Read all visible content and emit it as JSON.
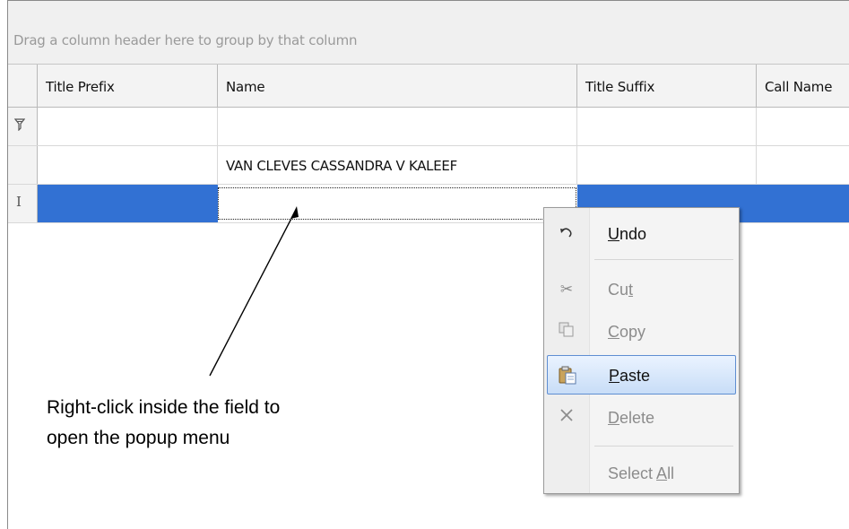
{
  "grid": {
    "group_panel_text": "Drag a column header here to group by that column",
    "columns": [
      "Title Prefix",
      "Name",
      "Title Suffix",
      "Call Name"
    ],
    "filter_row_icon": "filter-icon",
    "rows": [
      {
        "title_prefix": "",
        "name": "VAN CLEVES CASSANDRA V KALEEF",
        "title_suffix": "",
        "call_name": ""
      }
    ],
    "editing_row_icon": "text-cursor-icon",
    "selection_color": "#3271d3"
  },
  "context_menu": {
    "items": [
      {
        "pre": "",
        "key": "U",
        "post": "ndo",
        "icon": "undo-icon",
        "enabled": true
      },
      {
        "pre": "Cu",
        "key": "t",
        "post": "",
        "icon": "scissors-icon",
        "enabled": false
      },
      {
        "pre": "",
        "key": "C",
        "post": "opy",
        "icon": "copy-icon",
        "enabled": false
      },
      {
        "pre": "",
        "key": "P",
        "post": "aste",
        "icon": "clipboard-icon",
        "enabled": true,
        "highlighted": true
      },
      {
        "pre": "",
        "key": "D",
        "post": "elete",
        "icon": "delete-icon",
        "enabled": false
      },
      {
        "pre": "Select ",
        "key": "A",
        "post": "ll",
        "icon": "",
        "enabled": false
      }
    ]
  },
  "annotation": {
    "line1": "Right-click inside the field to",
    "line2": "open the popup menu"
  }
}
